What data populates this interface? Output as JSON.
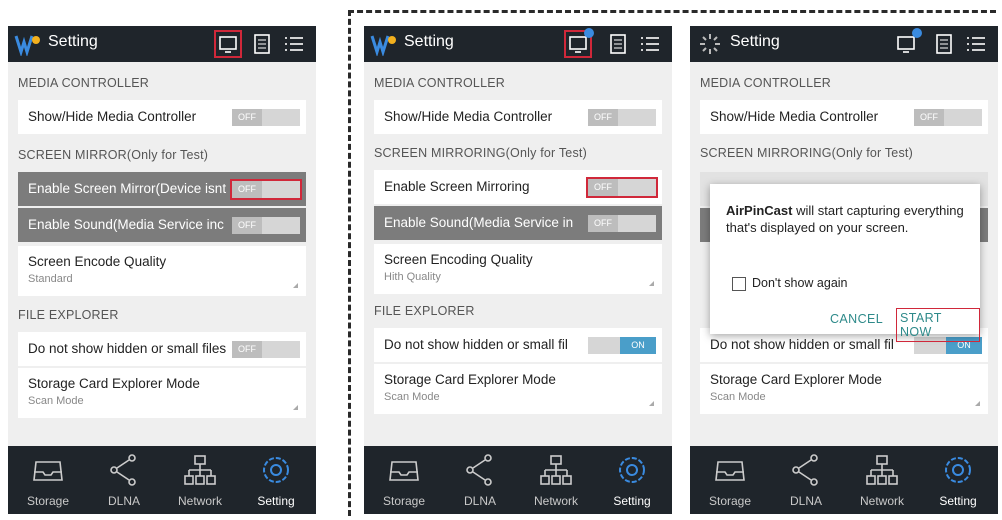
{
  "colors": {
    "topbar": "#1f252b",
    "accent": "#4a9ec9",
    "highlight": "#d0283a",
    "dialog_button": "#2e8a8a"
  },
  "screen1": {
    "title": "Setting",
    "sections": [
      "MEDIA CONTROLLER",
      "SCREEN MIRROR(Only for Test)",
      "FILE EXPLORER"
    ],
    "rows": [
      {
        "label": "Show/Hide Media Controller",
        "toggle": "OFF"
      },
      {
        "label": "Enable Screen Mirror(Device isnt",
        "toggle": "OFF"
      },
      {
        "label": "Enable Sound(Media Service inc",
        "toggle": "OFF"
      },
      {
        "label": "Screen Encode Quality",
        "sub": "Standard"
      },
      {
        "label": "Do not show hidden or small files",
        "toggle": "OFF"
      },
      {
        "label": "Storage Card Explorer Mode",
        "sub": "Scan Mode"
      }
    ]
  },
  "screen2": {
    "title": "Setting",
    "sections": [
      "MEDIA CONTROLLER",
      "SCREEN MIRRORING(Only for Test)",
      "FILE EXPLORER"
    ],
    "rows": [
      {
        "label": "Show/Hide Media Controller",
        "toggle": "OFF"
      },
      {
        "label": "Enable Screen Mirroring",
        "toggle": "OFF"
      },
      {
        "label": "Enable Sound(Media Service in",
        "toggle": "OFF"
      },
      {
        "label": "Screen Encoding Quality",
        "sub": "Hith Quality"
      },
      {
        "label": "Do not show hidden or small fil",
        "toggle": "ON"
      },
      {
        "label": "Storage Card Explorer Mode",
        "sub": "Scan Mode"
      }
    ]
  },
  "screen3": {
    "title": "Setting",
    "sections": [
      "MEDIA CONTROLLER",
      "SCREEN MIRRORING(Only for Test)"
    ],
    "rows": [
      {
        "label": "Show/Hide Media Controller",
        "toggle": "OFF"
      },
      {
        "label": "Do not show hidden or small fil",
        "toggle": "ON"
      },
      {
        "label": "Storage Card Explorer Mode",
        "sub": "Scan Mode"
      }
    ],
    "dialog": {
      "app_name": "AirPinCast",
      "message": " will start capturing everything that's displayed on your screen.",
      "checkbox_label": "Don't show again",
      "cancel": "CANCEL",
      "start": "START NOW"
    }
  },
  "tabs": [
    "Storage",
    "DLNA",
    "Network",
    "Setting"
  ],
  "icons": [
    "app-logo-icon",
    "monitor-icon",
    "list-icon",
    "menu-icon",
    "storage-tray-icon",
    "share-icon",
    "network-icon",
    "gear-icon"
  ]
}
